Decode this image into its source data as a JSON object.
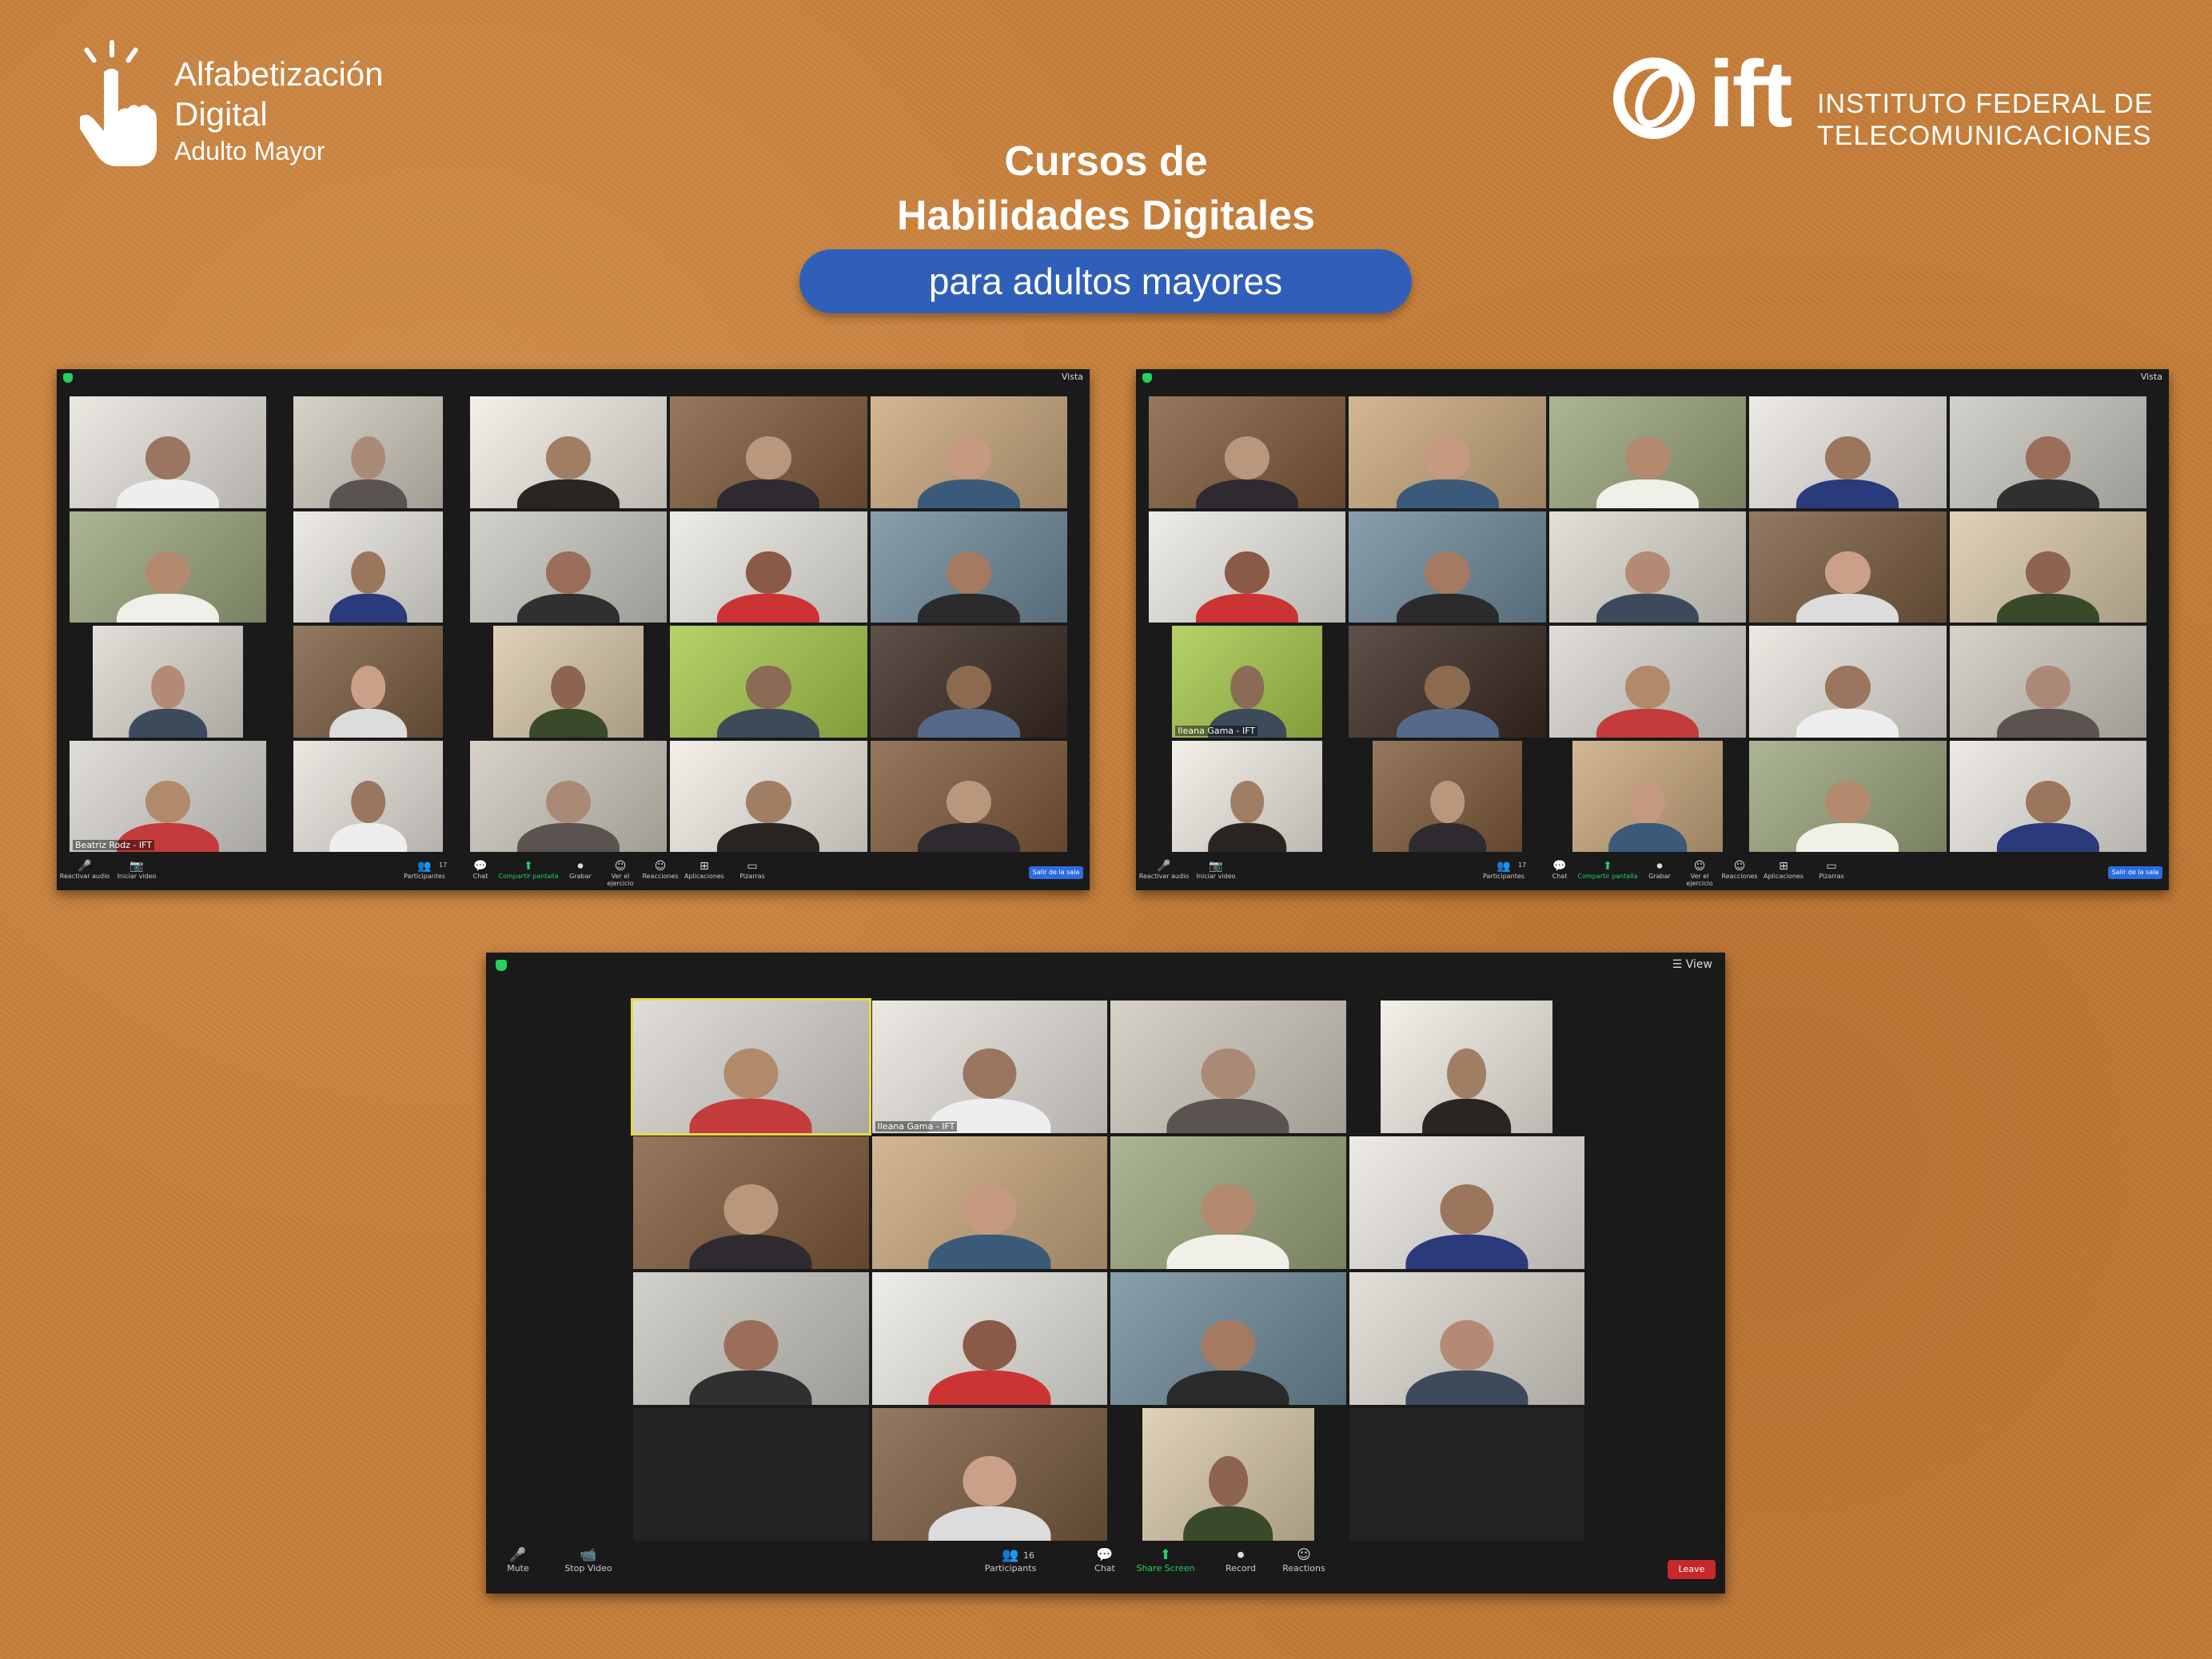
{
  "header": {
    "logo_left": {
      "line1": "Alfabetización",
      "line2": "Digital",
      "line3": "Adulto Mayor",
      "icon": "hand-tap-icon"
    },
    "logo_right": {
      "wordmark": "ift",
      "line1": "INSTITUTO FEDERAL DE",
      "line2": "TELECOMUNICACIONES",
      "icon": "ift-ring-icon"
    },
    "title_line1": "Cursos de",
    "title_line2": "Habilidades Digitales",
    "subtitle": "para adultos mayores"
  },
  "colors": {
    "background": "#c67e3a",
    "pill": "#2f5fb9",
    "zoom_bg": "#1a1a1a",
    "leave": "#c8282a",
    "end": "#2d6cdf",
    "share": "#23d160"
  },
  "meeting1": {
    "view_label": "Vista",
    "name_tags": [
      "Beatriz Rodz - IFT"
    ],
    "toolbar": {
      "mute": "Reactivar audio",
      "video": "Iniciar video",
      "participants_count": "17",
      "participants": "Participantes",
      "chat": "Chat",
      "share": "Compartir pantalla",
      "record": "Grabar",
      "reactions": "Reacciones",
      "apps": "Aplicaciones",
      "whiteboard": "Pizarras",
      "more": "Ver el ejercicio",
      "end": "Salir de la sala"
    }
  },
  "meeting2": {
    "view_label": "Vista",
    "name_tags": [
      "Ileana Gama - IFT"
    ],
    "toolbar": {
      "mute": "Reactivar audio",
      "video": "Iniciar video",
      "participants_count": "17",
      "participants": "Participantes",
      "chat": "Chat",
      "share": "Compartir pantalla",
      "record": "Grabar",
      "reactions": "Reacciones",
      "apps": "Aplicaciones",
      "whiteboard": "Pizarras",
      "more": "Ver el ejercicio",
      "end": "Salir de la sala"
    }
  },
  "meeting3": {
    "view_label": "View",
    "name_tags": [
      "Ileana Gama - IFT"
    ],
    "toolbar": {
      "mute": "Mute",
      "video": "Stop Video",
      "participants_count": "16",
      "participants": "Participants",
      "chat": "Chat",
      "share": "Share Screen",
      "record": "Record",
      "reactions": "Reactions",
      "end": "Leave"
    }
  }
}
